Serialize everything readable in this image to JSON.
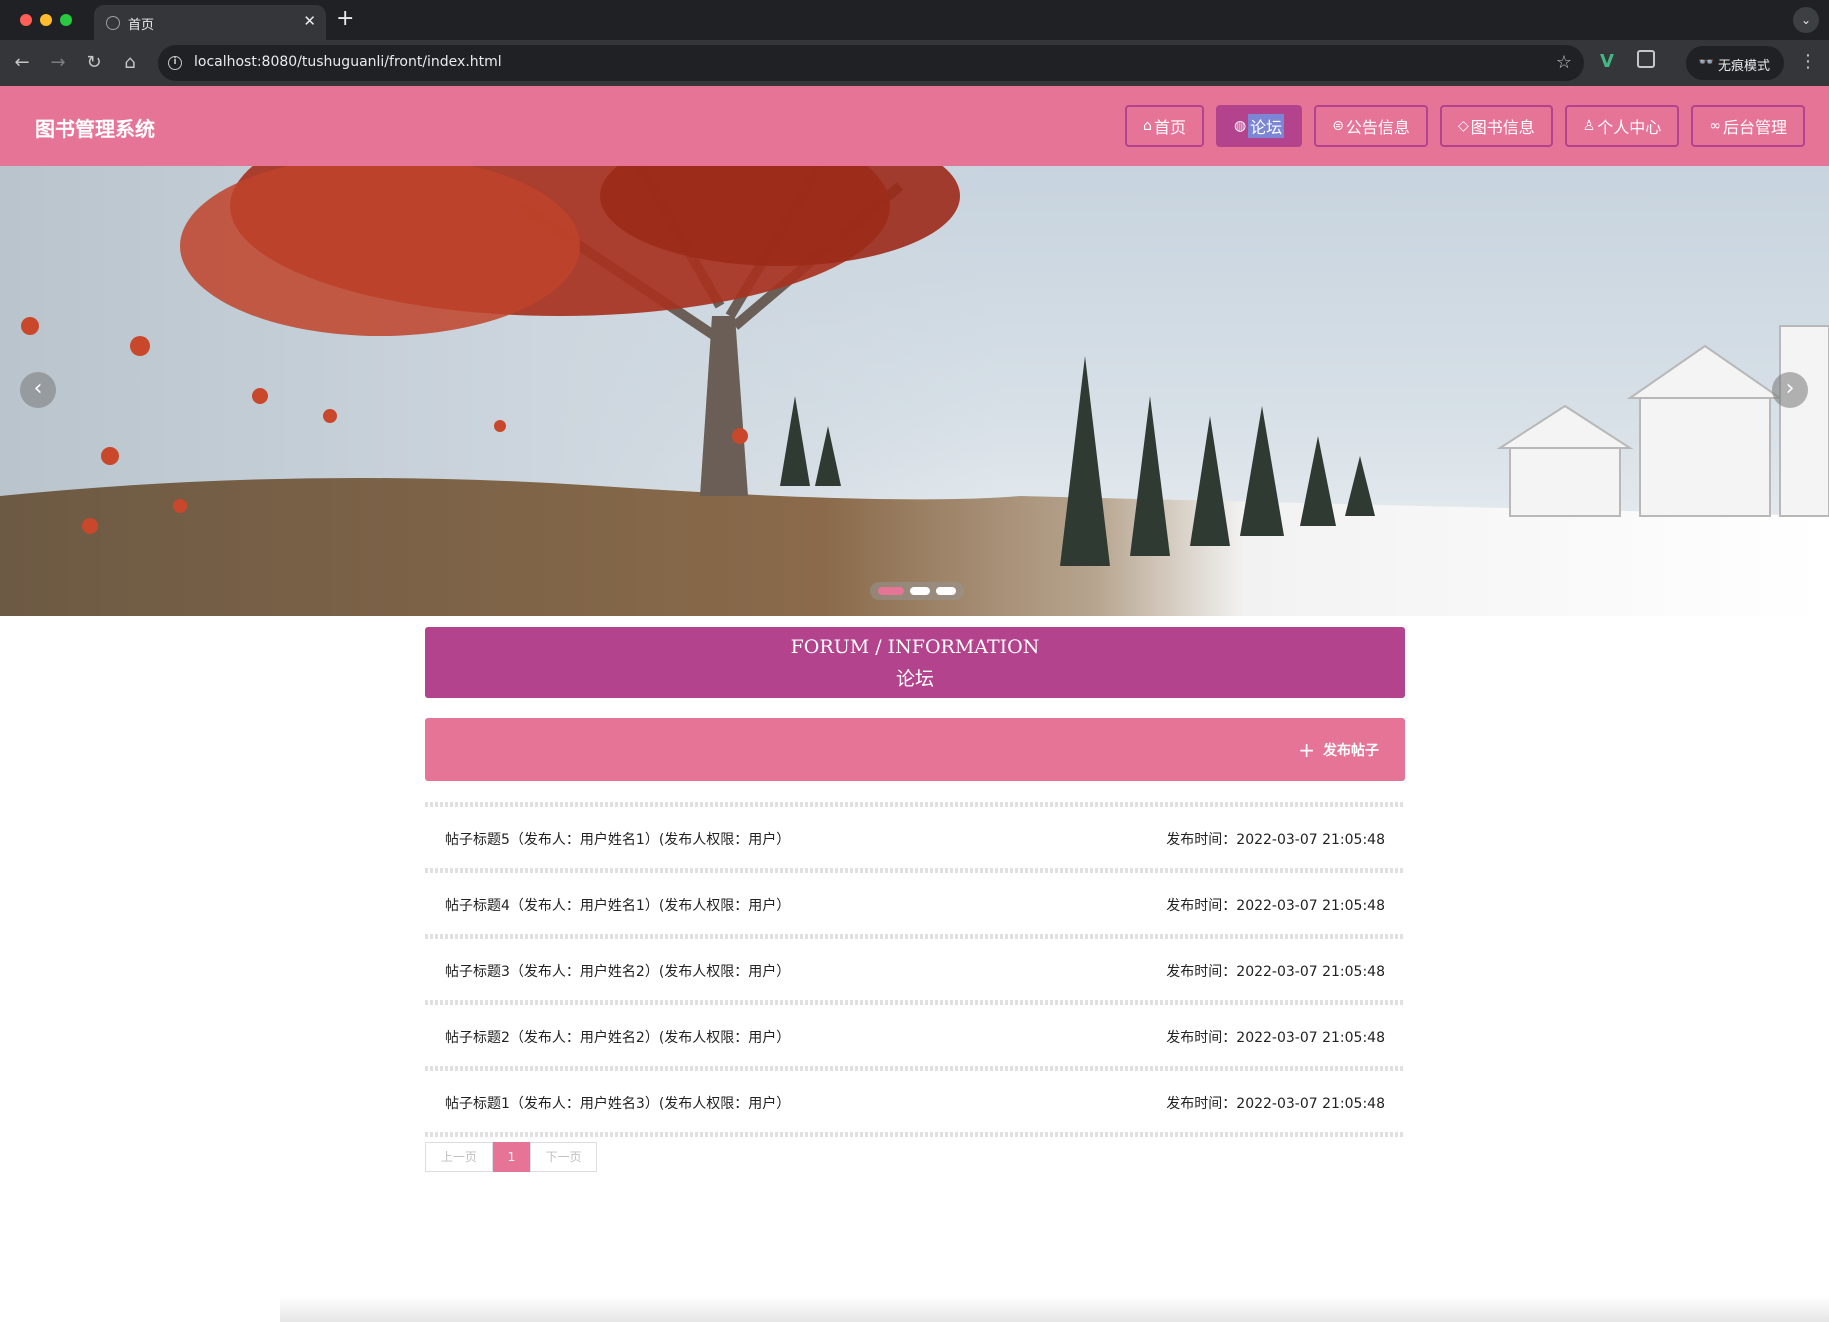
{
  "browser": {
    "tab_title": "首页",
    "url": "localhost:8080/tushuguanli/front/index.html",
    "incognito_label": "无痕模式"
  },
  "header": {
    "site_title": "图书管理系统",
    "nav": [
      {
        "label": "首页",
        "icon": "home-icon",
        "active": false
      },
      {
        "label": "论坛",
        "icon": "globe-icon",
        "active": true
      },
      {
        "label": "公告信息",
        "icon": "announcement-icon",
        "active": false
      },
      {
        "label": "图书信息",
        "icon": "tag-icon",
        "active": false
      },
      {
        "label": "个人中心",
        "icon": "user-icon",
        "active": false
      },
      {
        "label": "后台管理",
        "icon": "link-icon",
        "active": false
      }
    ]
  },
  "banner": {
    "slide_count": 3,
    "active_slide": 1
  },
  "forum": {
    "heading_en": "FORUM / INFORMATION",
    "heading_cn": "论坛",
    "post_button": "发布帖子",
    "posts": [
      {
        "title": "帖子标题5（发布人：用户姓名1）(发布人权限：用户）",
        "time": "发布时间：2022-03-07 21:05:48"
      },
      {
        "title": "帖子标题4（发布人：用户姓名1）(发布人权限：用户）",
        "time": "发布时间：2022-03-07 21:05:48"
      },
      {
        "title": "帖子标题3（发布人：用户姓名2）(发布人权限：用户）",
        "time": "发布时间：2022-03-07 21:05:48"
      },
      {
        "title": "帖子标题2（发布人：用户姓名2）(发布人权限：用户）",
        "time": "发布时间：2022-03-07 21:05:48"
      },
      {
        "title": "帖子标题1（发布人：用户姓名3）(发布人权限：用户）",
        "time": "发布时间：2022-03-07 21:05:48"
      }
    ]
  },
  "pagination": {
    "prev": "上一页",
    "current": "1",
    "next": "下一页"
  },
  "colors": {
    "primary": "#e57497",
    "accent": "#b4438d"
  }
}
